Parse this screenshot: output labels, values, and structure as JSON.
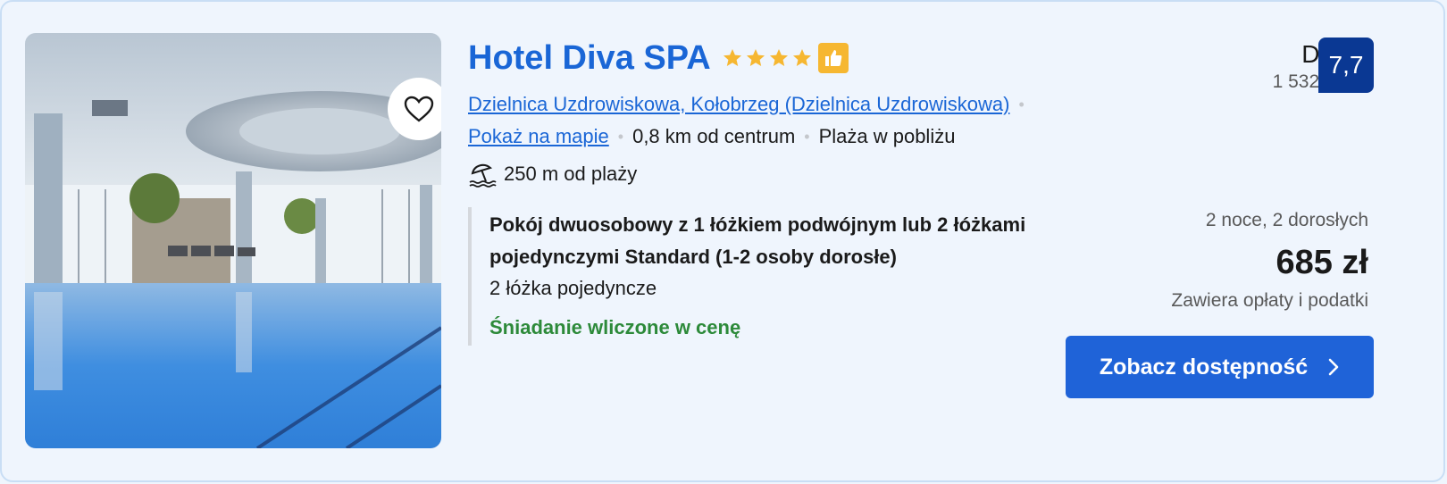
{
  "hotel": {
    "name": "Hotel Diva SPA",
    "stars": 4,
    "location_link": "Dzielnica Uzdrowiskowa, Kołobrzeg (Dzielnica Uzdrowiskowa)",
    "map_link": "Pokaż na mapie",
    "distance_center": "0,8 km od centrum",
    "beach_nearby": "Plaża w pobliżu",
    "beach_distance": "250 m od plaży"
  },
  "room": {
    "name": "Pokój dwuosobowy z 1 łóżkiem podwójnym lub 2 łóżkami pojedynczymi Standard (1-2 osoby dorosłe)",
    "beds": "2 łóżka pojedyncze",
    "breakfast": "Śniadanie wliczone w cenę"
  },
  "review": {
    "word": "Dobry",
    "count": "1 532 opinii",
    "score": "7,7"
  },
  "pricing": {
    "stay": "2 noce, 2 dorosłych",
    "price": "685 zł",
    "taxes": "Zawiera opłaty i podatki"
  },
  "cta": {
    "label": "Zobacz dostępność"
  },
  "colors": {
    "brand_blue": "#1a66d6",
    "score_bg": "#0a3893",
    "star": "#f6b731",
    "breakfast_green": "#2d8a3a",
    "cta_bg": "#1f63d8"
  },
  "icons": {
    "favorite": "heart-outline-icon",
    "preferred": "thumbs-up-icon",
    "beach": "beach-umbrella-icon",
    "cta_arrow": "chevron-right-icon"
  }
}
